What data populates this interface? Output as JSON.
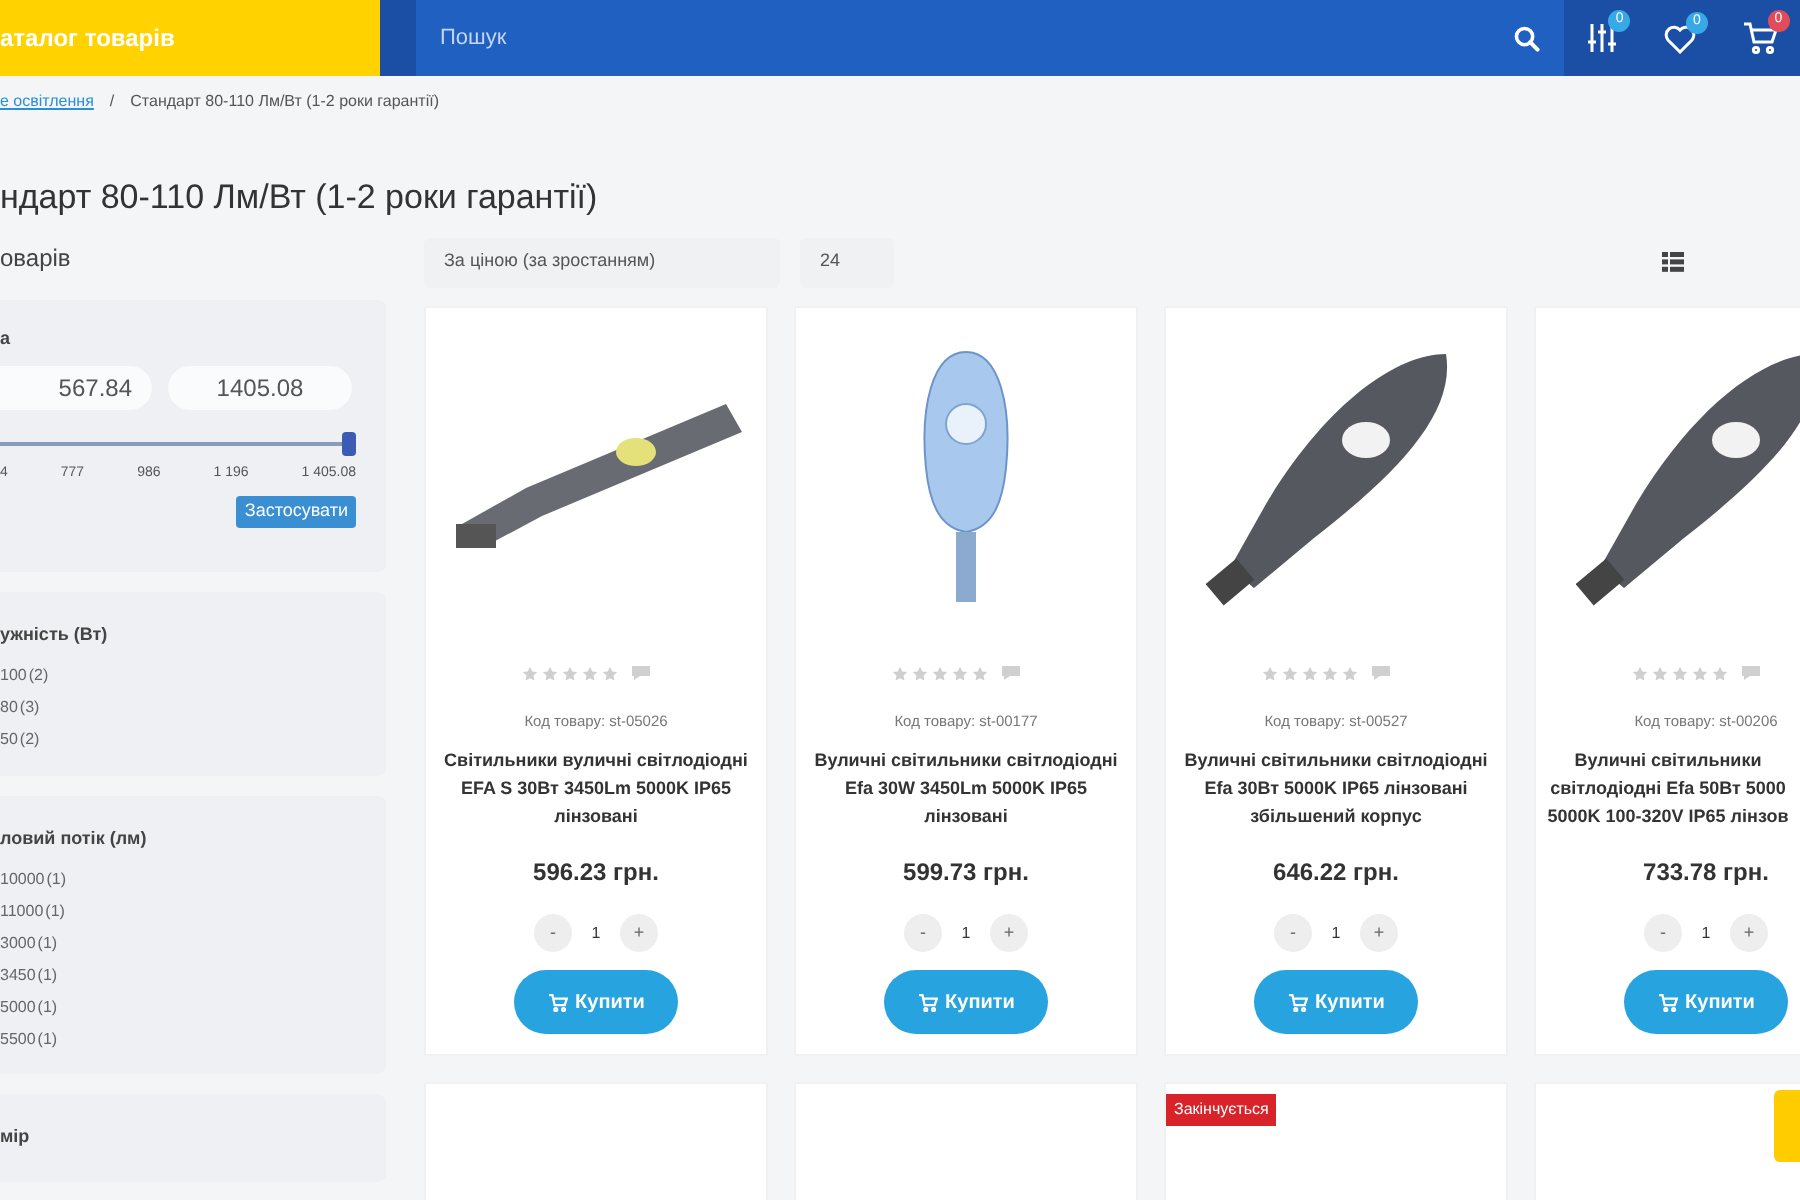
{
  "header": {
    "catalog_button": "аталог товарів",
    "search": {
      "placeholder": "Пошук"
    },
    "icons": [
      {
        "kind": "compare",
        "count": "0"
      },
      {
        "kind": "wishlist",
        "count": "0"
      },
      {
        "kind": "cart",
        "count": "0"
      }
    ]
  },
  "breadcrumb": {
    "separator": "/",
    "items": [
      {
        "label": "е освітлення",
        "kind": "link"
      },
      {
        "label": "Стандарт 80-110 Лм/Вт (1-2 роки гарантії)",
        "kind": "current"
      }
    ]
  },
  "title": "ндарт 80-110 Лм/Вт (1-2 роки гарантії)",
  "sidebar": {
    "heading": "оварів",
    "price_filter": {
      "title": "а",
      "min": "567.84",
      "max": "1405.08",
      "level": 1,
      "ticks": [
        "4",
        "777",
        "986",
        "1 196",
        "1 405.08"
      ],
      "apply": "Застосувати"
    },
    "groups": [
      {
        "title": "ужність (Вт)",
        "options": [
          {
            "value": "100",
            "count": "(2)"
          },
          {
            "value": "80",
            "count": "(3)"
          },
          {
            "value": "50",
            "count": "(2)"
          }
        ]
      },
      {
        "title": "ловий потік (лм)",
        "options": [
          {
            "value": "10000",
            "count": "(1)"
          },
          {
            "value": "11000",
            "count": "(1)"
          },
          {
            "value": "3000",
            "count": "(1)"
          },
          {
            "value": "3450",
            "count": "(1)"
          },
          {
            "value": "5000",
            "count": "(1)"
          },
          {
            "value": "5500",
            "count": "(1)"
          }
        ]
      },
      {
        "title": "мір"
      }
    ]
  },
  "toolbar": {
    "sort": "За ціною (за зростанням)",
    "per_page": "24"
  },
  "products": [
    {
      "kind": "flat",
      "stars": 0,
      "code": "Код товару: st-05026",
      "name": "Світильники вуличні світлодіодні EFA S 30Вт 3450Lm 5000K IP65 лінзовані",
      "price": "596.23 грн.",
      "minus": "-",
      "qty": "1",
      "plus": "+",
      "buy": "Купити"
    },
    {
      "kind": "upright",
      "stars": 0,
      "code": "Код товару: st-00177",
      "name": "Вуличні світильники світлодіодні Efa 30W 3450Lm 5000K IP65 лінзовані",
      "price": "599.73 грн.",
      "minus": "-",
      "qty": "1",
      "plus": "+",
      "buy": "Купити"
    },
    {
      "kind": "angled",
      "stars": 0,
      "code": "Код товару: st-00527",
      "name": "Вуличні світильники світлодіодні Efa 30Вт 5000K IP65 лінзовані збільшений корпус",
      "price": "646.22 грн.",
      "minus": "-",
      "qty": "1",
      "plus": "+",
      "buy": "Купити"
    },
    {
      "kind": "angled",
      "stars": 0,
      "code": "Код товару: st-00206",
      "name": "Вуличні світильники світлодіодні Efa 50Вт 5000 5000K 100-320V IP65 лінзов",
      "price": "733.78 грн.",
      "minus": "-",
      "qty": "1",
      "plus": "+",
      "buy": "Купити"
    }
  ],
  "products_row2": [
    {
      "kind": "plain"
    },
    {
      "kind": "plain"
    },
    {
      "kind": "badged",
      "badge": "Закінчується"
    },
    {
      "kind": "plain"
    }
  ]
}
